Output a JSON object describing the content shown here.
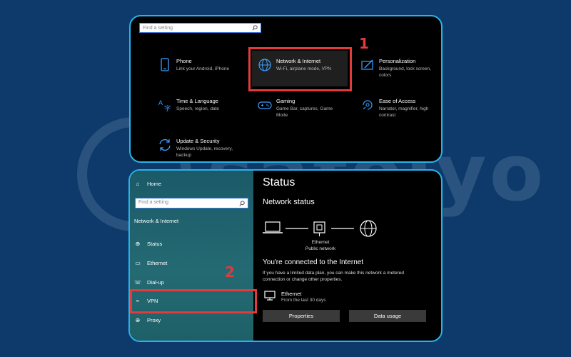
{
  "colors": {
    "background": "#0d3a6b",
    "panel_border": "#29b3e8",
    "accent_red": "#e13b3b",
    "icon_blue": "#3aa0ff"
  },
  "watermark": {
    "word": "safelyo"
  },
  "settings_home": {
    "search_placeholder": "Find a setting",
    "tiles": [
      {
        "icon": "phone-icon",
        "title": "Phone",
        "desc": "Link your Android, iPhone"
      },
      {
        "icon": "globe-icon",
        "title": "Network & Internet",
        "desc": "Wi-Fi, airplane mode, VPN"
      },
      {
        "icon": "personalization-icon",
        "title": "Personalization",
        "desc": "Background, lock screen, colors"
      },
      {
        "icon": "time-language-icon",
        "title": "Time & Language",
        "desc": "Speech, region, date"
      },
      {
        "icon": "gamepad-icon",
        "title": "Gaming",
        "desc": "Game Bar, captures, Game Mode"
      },
      {
        "icon": "ease-of-access-icon",
        "title": "Ease of Access",
        "desc": "Narrator, magnifier, high contrast"
      },
      {
        "icon": "sync-icon",
        "title": "Update & Security",
        "desc": "Windows Update, recovery, backup"
      }
    ],
    "step_number": "1"
  },
  "network_page": {
    "sidebar": {
      "home_label": "Home",
      "search_placeholder": "Find a setting",
      "section_label": "Network & Internet",
      "items": [
        {
          "icon": "status-icon",
          "label": "Status"
        },
        {
          "icon": "ethernet-icon",
          "label": "Ethernet"
        },
        {
          "icon": "dialup-icon",
          "label": "Dial-up"
        },
        {
          "icon": "vpn-icon",
          "label": "VPN"
        },
        {
          "icon": "proxy-icon",
          "label": "Proxy"
        }
      ]
    },
    "step_number": "2",
    "title": "Status",
    "network_status_heading": "Network status",
    "diagram_label_line1": "Ethernet",
    "diagram_label_line2": "Public network",
    "connected_heading": "You're connected to the Internet",
    "connected_desc": "If you have a limited data plan, you can make this network a metered connection or change other properties.",
    "ethernet_item": {
      "title": "Ethernet",
      "subtitle": "From the last 30 days"
    },
    "buttons": {
      "properties": "Properties",
      "data_usage": "Data usage"
    }
  }
}
